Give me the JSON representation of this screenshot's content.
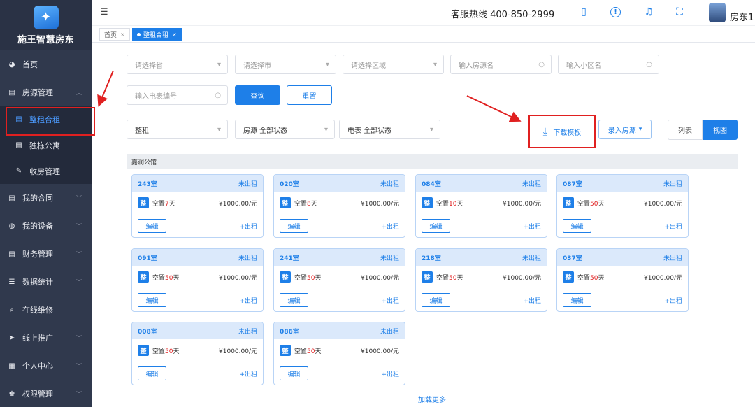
{
  "brand": {
    "name": "施王智慧房东",
    "logo_glyph": "✦",
    "accent": "#1e7fe8",
    "sidebar_bg": "#30394d"
  },
  "topbar": {
    "menu_icon": "menu-icon",
    "hotline": "客服热线 400-850-2999",
    "icons": [
      "tablet-icon",
      "info-icon",
      "bell-icon",
      "fullscreen-icon"
    ],
    "username": "房东1"
  },
  "tabs": [
    {
      "label": "首页",
      "active": false
    },
    {
      "label": "整租合租",
      "active": true
    }
  ],
  "sidebar": {
    "items": [
      {
        "label": "首页",
        "icon": "palette-icon"
      },
      {
        "label": "房源管理",
        "icon": "document-icon",
        "expanded": true
      },
      {
        "label": "整租合租",
        "icon": "document-icon",
        "sub": true,
        "active": true
      },
      {
        "label": "独栋公寓",
        "icon": "document-icon",
        "sub": true
      },
      {
        "label": "收房管理",
        "icon": "edit-icon",
        "sub": true
      },
      {
        "label": "我的合同",
        "icon": "document-icon"
      },
      {
        "label": "我的设备",
        "icon": "devices-icon"
      },
      {
        "label": "财务管理",
        "icon": "document-icon"
      },
      {
        "label": "数据统计",
        "icon": "list-icon"
      },
      {
        "label": "在线维修",
        "icon": "search-icon"
      },
      {
        "label": "线上推广",
        "icon": "send-icon"
      },
      {
        "label": "个人中心",
        "icon": "grid-icon"
      },
      {
        "label": "权限管理",
        "icon": "users-icon"
      }
    ]
  },
  "filters": {
    "province_placeholder": "请选择省",
    "city_placeholder": "请选择市",
    "district_placeholder": "请选择区域",
    "house_name_placeholder": "输入房源名",
    "community_placeholder": "输入小区名",
    "meter_placeholder": "输入电表编号",
    "query_label": "查询",
    "reset_label": "重置"
  },
  "toolbar": {
    "rent_type": "整租",
    "house_status": "房源  全部状态",
    "meter_status": "电表  全部状态",
    "download_label": "下载模板",
    "enter_house_label": "录入房源",
    "list_label": "列表",
    "view_label": "视图"
  },
  "group": {
    "title": "嘉润公馆"
  },
  "rooms": [
    {
      "room": "243室",
      "status": "未出租",
      "vacant_prefix": "空置",
      "vacant_days": "7",
      "vacant_suffix": "天",
      "price": "¥1000.00/元",
      "edit": "编辑",
      "rent": "+出租"
    },
    {
      "room": "020室",
      "status": "未出租",
      "vacant_prefix": "空置",
      "vacant_days": "8",
      "vacant_suffix": "天",
      "price": "¥1000.00/元",
      "edit": "编辑",
      "rent": "+出租"
    },
    {
      "room": "084室",
      "status": "未出租",
      "vacant_prefix": "空置",
      "vacant_days": "10",
      "vacant_suffix": "天",
      "price": "¥1000.00/元",
      "edit": "编辑",
      "rent": "+出租"
    },
    {
      "room": "087室",
      "status": "未出租",
      "vacant_prefix": "空置",
      "vacant_days": "50",
      "vacant_suffix": "天",
      "price": "¥1000.00/元",
      "edit": "编辑",
      "rent": "+出租"
    },
    {
      "room": "091室",
      "status": "未出租",
      "vacant_prefix": "空置",
      "vacant_days": "50",
      "vacant_suffix": "天",
      "price": "¥1000.00/元",
      "edit": "编辑",
      "rent": "+出租"
    },
    {
      "room": "241室",
      "status": "未出租",
      "vacant_prefix": "空置",
      "vacant_days": "50",
      "vacant_suffix": "天",
      "price": "¥1000.00/元",
      "edit": "编辑",
      "rent": "+出租"
    },
    {
      "room": "218室",
      "status": "未出租",
      "vacant_prefix": "空置",
      "vacant_days": "50",
      "vacant_suffix": "天",
      "price": "¥1000.00/元",
      "edit": "编辑",
      "rent": "+出租"
    },
    {
      "room": "037室",
      "status": "未出租",
      "vacant_prefix": "空置",
      "vacant_days": "50",
      "vacant_suffix": "天",
      "price": "¥1000.00/元",
      "edit": "编辑",
      "rent": "+出租"
    },
    {
      "room": "008室",
      "status": "未出租",
      "vacant_prefix": "空置",
      "vacant_days": "50",
      "vacant_suffix": "天",
      "price": "¥1000.00/元",
      "edit": "编辑",
      "rent": "+出租"
    },
    {
      "room": "086室",
      "status": "未出租",
      "vacant_prefix": "空置",
      "vacant_days": "50",
      "vacant_suffix": "天",
      "price": "¥1000.00/元",
      "edit": "编辑",
      "rent": "+出租"
    }
  ],
  "badge_glyph": "整",
  "load_more": "加载更多"
}
